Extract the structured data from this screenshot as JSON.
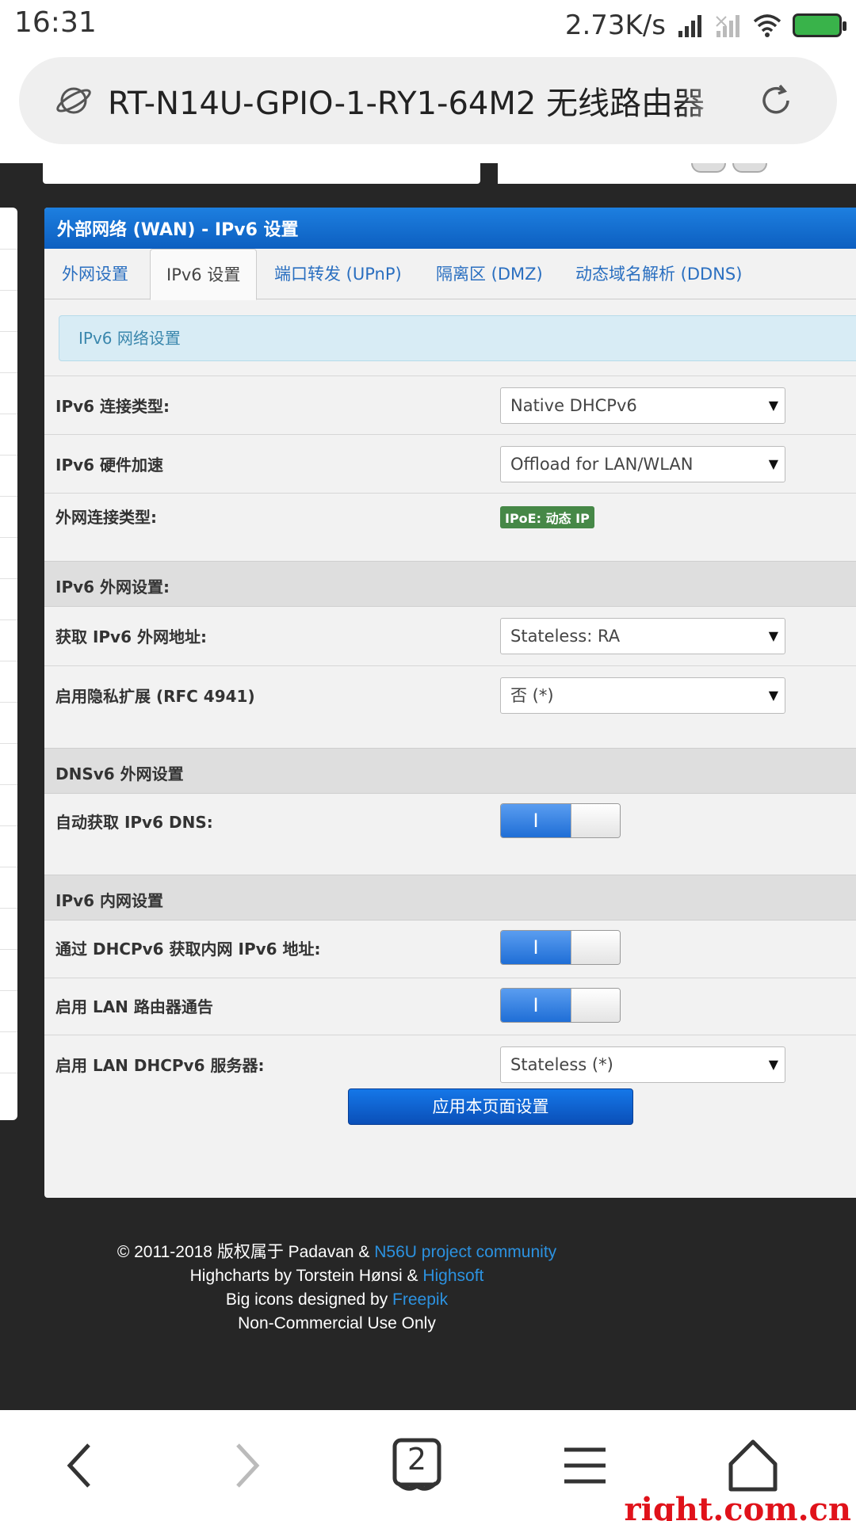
{
  "status_bar": {
    "time": "16:31",
    "net_speed": "2.73K/s",
    "battery_color": "#39b34a"
  },
  "browser": {
    "url": "RT-N14U-GPIO-1-RY1-64M2 无线路由器",
    "tab_count": "2",
    "icons": [
      "planet-icon",
      "reload-icon",
      "back-icon",
      "forward-icon",
      "tabs-icon",
      "menu-icon",
      "home-icon"
    ]
  },
  "panel": {
    "title": "外部网络 (WAN) - IPv6 设置",
    "tabs": [
      "外网设置",
      "IPv6 设置",
      "端口转发 (UPnP)",
      "隔离区 (DMZ)",
      "动态域名解析 (DDNS)"
    ],
    "active_tab": "IPv6 设置",
    "info_box": "IPv6 网络设置"
  },
  "settings": {
    "conn_type": {
      "label": "IPv6 连接类型:",
      "value": "Native DHCPv6"
    },
    "hw_accel": {
      "label": "IPv6 硬件加速",
      "value": "Offload for LAN/WLAN"
    },
    "wan_type": {
      "label": "外网连接类型:",
      "badge": "IPoE: 动态 IP"
    },
    "wan_section": "IPv6 外网设置:",
    "get_addr": {
      "label": "获取 IPv6 外网地址:",
      "value": "Stateless: RA"
    },
    "privacy": {
      "label": "启用隐私扩展 (RFC 4941)",
      "value": "否 (*)"
    },
    "dns_section": "DNSv6 外网设置",
    "auto_dns": {
      "label": "自动获取 IPv6 DNS:",
      "state": "I"
    },
    "lan_section": "IPv6 内网设置",
    "dhcp_lan": {
      "label": "通过 DHCPv6 获取内网 IPv6 地址:",
      "state": "I"
    },
    "ra": {
      "label": "启用 LAN 路由器通告",
      "state": "I"
    },
    "dhcp_server": {
      "label": "启用 LAN DHCPv6 服务器:",
      "value": "Stateless (*)"
    }
  },
  "apply_button": "应用本页面设置",
  "footer": {
    "line1_prefix": "© 2011-2018 版权属于 Padavan & ",
    "line1_link": "N56U project community",
    "line2_prefix": "Highcharts by Torstein Hønsi & ",
    "line2_link": "Highsoft",
    "line3_prefix": "Big icons designed by ",
    "line3_link": "Freepik",
    "line4": "Non-Commercial Use Only"
  },
  "watermark": "right.com.cn",
  "colors": {
    "header_blue": "#0d5fc0",
    "link_blue": "#2c92e0",
    "badge_green": "#468847"
  }
}
